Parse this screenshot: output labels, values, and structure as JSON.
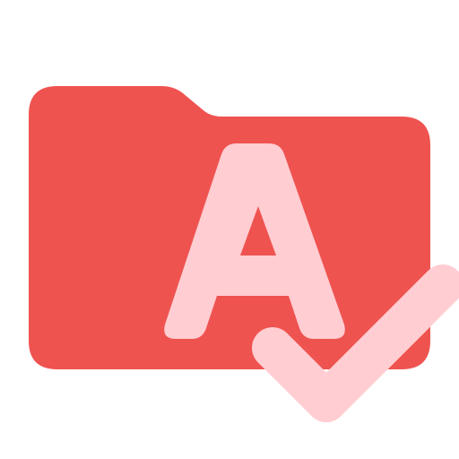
{
  "icon": {
    "name": "folder-a-check-icon",
    "colors": {
      "folder": "#ef5350",
      "glyph": "#ffcdd2",
      "background": "#ffffff"
    },
    "parts": [
      "folder-icon",
      "letter-a-glyph",
      "checkmark-icon"
    ]
  }
}
